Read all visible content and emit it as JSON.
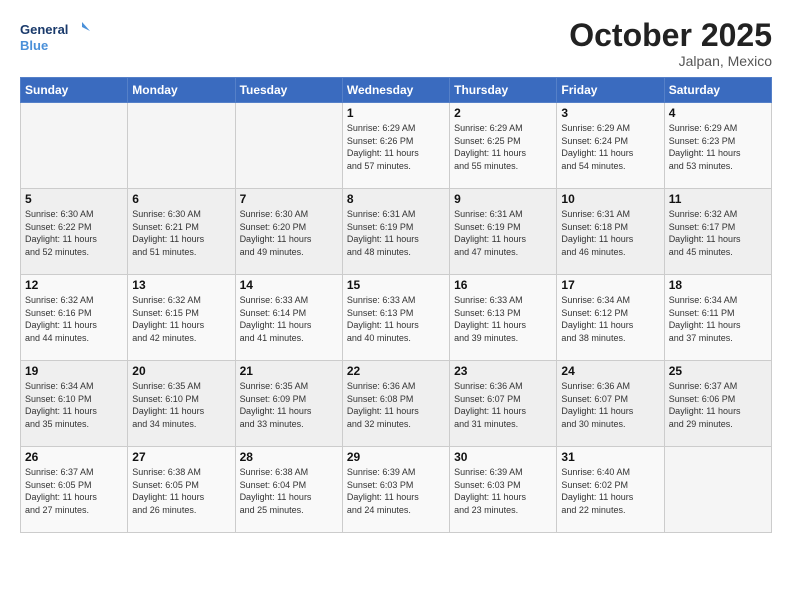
{
  "header": {
    "logo_general": "General",
    "logo_blue": "Blue",
    "month_title": "October 2025",
    "subtitle": "Jalpan, Mexico"
  },
  "weekdays": [
    "Sunday",
    "Monday",
    "Tuesday",
    "Wednesday",
    "Thursday",
    "Friday",
    "Saturday"
  ],
  "weeks": [
    [
      {
        "day": "",
        "info": ""
      },
      {
        "day": "",
        "info": ""
      },
      {
        "day": "",
        "info": ""
      },
      {
        "day": "1",
        "info": "Sunrise: 6:29 AM\nSunset: 6:26 PM\nDaylight: 11 hours\nand 57 minutes."
      },
      {
        "day": "2",
        "info": "Sunrise: 6:29 AM\nSunset: 6:25 PM\nDaylight: 11 hours\nand 55 minutes."
      },
      {
        "day": "3",
        "info": "Sunrise: 6:29 AM\nSunset: 6:24 PM\nDaylight: 11 hours\nand 54 minutes."
      },
      {
        "day": "4",
        "info": "Sunrise: 6:29 AM\nSunset: 6:23 PM\nDaylight: 11 hours\nand 53 minutes."
      }
    ],
    [
      {
        "day": "5",
        "info": "Sunrise: 6:30 AM\nSunset: 6:22 PM\nDaylight: 11 hours\nand 52 minutes."
      },
      {
        "day": "6",
        "info": "Sunrise: 6:30 AM\nSunset: 6:21 PM\nDaylight: 11 hours\nand 51 minutes."
      },
      {
        "day": "7",
        "info": "Sunrise: 6:30 AM\nSunset: 6:20 PM\nDaylight: 11 hours\nand 49 minutes."
      },
      {
        "day": "8",
        "info": "Sunrise: 6:31 AM\nSunset: 6:19 PM\nDaylight: 11 hours\nand 48 minutes."
      },
      {
        "day": "9",
        "info": "Sunrise: 6:31 AM\nSunset: 6:19 PM\nDaylight: 11 hours\nand 47 minutes."
      },
      {
        "day": "10",
        "info": "Sunrise: 6:31 AM\nSunset: 6:18 PM\nDaylight: 11 hours\nand 46 minutes."
      },
      {
        "day": "11",
        "info": "Sunrise: 6:32 AM\nSunset: 6:17 PM\nDaylight: 11 hours\nand 45 minutes."
      }
    ],
    [
      {
        "day": "12",
        "info": "Sunrise: 6:32 AM\nSunset: 6:16 PM\nDaylight: 11 hours\nand 44 minutes."
      },
      {
        "day": "13",
        "info": "Sunrise: 6:32 AM\nSunset: 6:15 PM\nDaylight: 11 hours\nand 42 minutes."
      },
      {
        "day": "14",
        "info": "Sunrise: 6:33 AM\nSunset: 6:14 PM\nDaylight: 11 hours\nand 41 minutes."
      },
      {
        "day": "15",
        "info": "Sunrise: 6:33 AM\nSunset: 6:13 PM\nDaylight: 11 hours\nand 40 minutes."
      },
      {
        "day": "16",
        "info": "Sunrise: 6:33 AM\nSunset: 6:13 PM\nDaylight: 11 hours\nand 39 minutes."
      },
      {
        "day": "17",
        "info": "Sunrise: 6:34 AM\nSunset: 6:12 PM\nDaylight: 11 hours\nand 38 minutes."
      },
      {
        "day": "18",
        "info": "Sunrise: 6:34 AM\nSunset: 6:11 PM\nDaylight: 11 hours\nand 37 minutes."
      }
    ],
    [
      {
        "day": "19",
        "info": "Sunrise: 6:34 AM\nSunset: 6:10 PM\nDaylight: 11 hours\nand 35 minutes."
      },
      {
        "day": "20",
        "info": "Sunrise: 6:35 AM\nSunset: 6:10 PM\nDaylight: 11 hours\nand 34 minutes."
      },
      {
        "day": "21",
        "info": "Sunrise: 6:35 AM\nSunset: 6:09 PM\nDaylight: 11 hours\nand 33 minutes."
      },
      {
        "day": "22",
        "info": "Sunrise: 6:36 AM\nSunset: 6:08 PM\nDaylight: 11 hours\nand 32 minutes."
      },
      {
        "day": "23",
        "info": "Sunrise: 6:36 AM\nSunset: 6:07 PM\nDaylight: 11 hours\nand 31 minutes."
      },
      {
        "day": "24",
        "info": "Sunrise: 6:36 AM\nSunset: 6:07 PM\nDaylight: 11 hours\nand 30 minutes."
      },
      {
        "day": "25",
        "info": "Sunrise: 6:37 AM\nSunset: 6:06 PM\nDaylight: 11 hours\nand 29 minutes."
      }
    ],
    [
      {
        "day": "26",
        "info": "Sunrise: 6:37 AM\nSunset: 6:05 PM\nDaylight: 11 hours\nand 27 minutes."
      },
      {
        "day": "27",
        "info": "Sunrise: 6:38 AM\nSunset: 6:05 PM\nDaylight: 11 hours\nand 26 minutes."
      },
      {
        "day": "28",
        "info": "Sunrise: 6:38 AM\nSunset: 6:04 PM\nDaylight: 11 hours\nand 25 minutes."
      },
      {
        "day": "29",
        "info": "Sunrise: 6:39 AM\nSunset: 6:03 PM\nDaylight: 11 hours\nand 24 minutes."
      },
      {
        "day": "30",
        "info": "Sunrise: 6:39 AM\nSunset: 6:03 PM\nDaylight: 11 hours\nand 23 minutes."
      },
      {
        "day": "31",
        "info": "Sunrise: 6:40 AM\nSunset: 6:02 PM\nDaylight: 11 hours\nand 22 minutes."
      },
      {
        "day": "",
        "info": ""
      }
    ]
  ]
}
